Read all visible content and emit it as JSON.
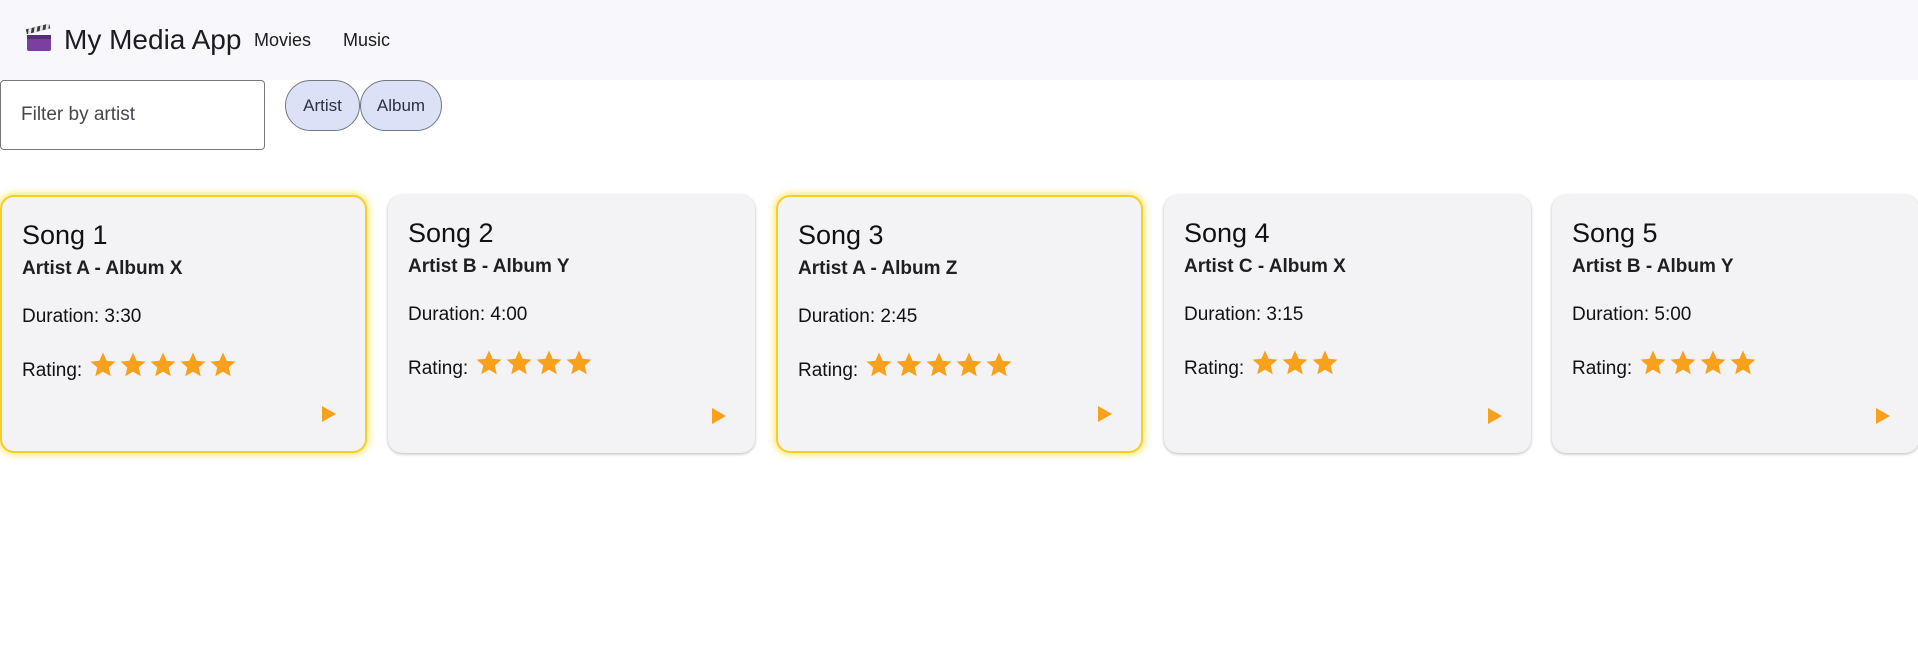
{
  "app": {
    "title": "My Media App",
    "icon": "clapperboard-icon"
  },
  "nav": {
    "movies": "Movies",
    "music": "Music"
  },
  "filter": {
    "placeholder": "Filter by artist",
    "value": ""
  },
  "chips": {
    "artist": "Artist",
    "album": "Album"
  },
  "rating_label": "Rating:",
  "colors": {
    "star": "#f9a11b",
    "highlight": "#f4cf2a",
    "chip_bg": "#dbe1f7",
    "card_bg": "#f3f2f5"
  },
  "songs": [
    {
      "title": "Song 1",
      "subtitle": "Artist A - Album X",
      "duration": "Duration: 3:30",
      "rating": 5,
      "highlighted": true
    },
    {
      "title": "Song 2",
      "subtitle": "Artist B - Album Y",
      "duration": "Duration: 4:00",
      "rating": 4,
      "highlighted": false
    },
    {
      "title": "Song 3",
      "subtitle": "Artist A - Album Z",
      "duration": "Duration: 2:45",
      "rating": 5,
      "highlighted": true
    },
    {
      "title": "Song 4",
      "subtitle": "Artist C - Album X",
      "duration": "Duration: 3:15",
      "rating": 3,
      "highlighted": false
    },
    {
      "title": "Song 5",
      "subtitle": "Artist B - Album Y",
      "duration": "Duration: 5:00",
      "rating": 4,
      "highlighted": false
    }
  ]
}
